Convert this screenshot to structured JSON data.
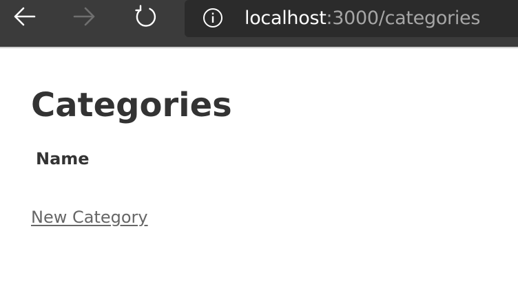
{
  "browser": {
    "url_host": "localhost",
    "url_rest": ":3000/categories",
    "toolbar_color": "#3b3b3b"
  },
  "page": {
    "title": "Categories",
    "table": {
      "columns": [
        "Name"
      ],
      "rows": []
    },
    "new_link": "New Category"
  }
}
